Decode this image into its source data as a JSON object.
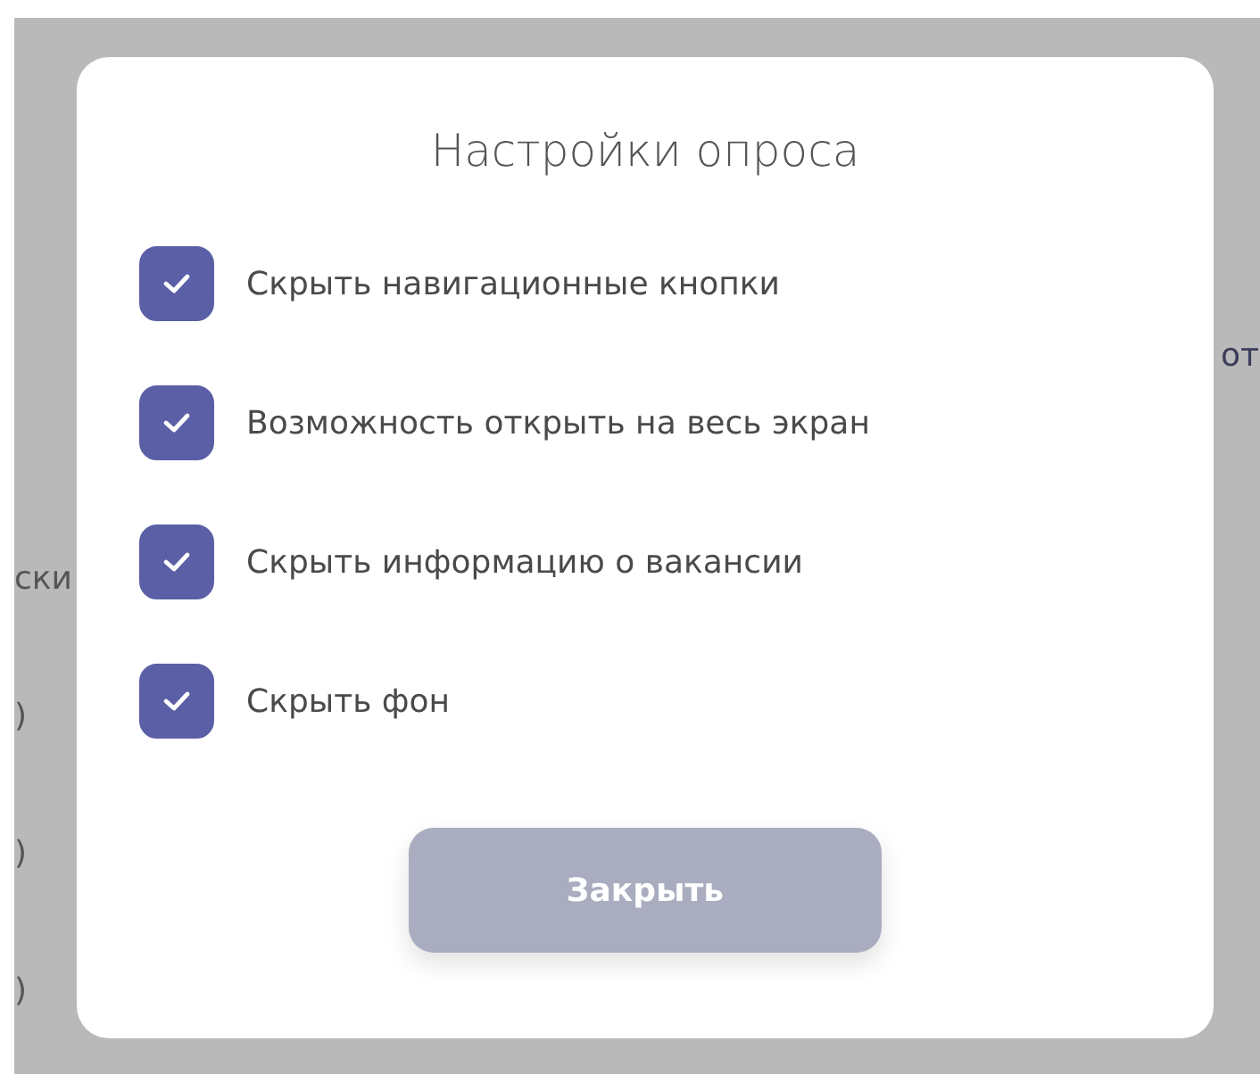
{
  "background": {
    "left_fragments": [
      "ски",
      ")",
      ")",
      ")"
    ],
    "right_fragments": [
      "от"
    ]
  },
  "dialog": {
    "title": "Настройки опроса",
    "options": [
      {
        "label": "Скрыть навигационные кнопки",
        "checked": true
      },
      {
        "label": "Возможность открыть на весь экран",
        "checked": true
      },
      {
        "label": "Скрыть информацию о вакансии",
        "checked": true
      },
      {
        "label": "Скрыть фон",
        "checked": true
      }
    ],
    "close_button": "Закрыть"
  }
}
